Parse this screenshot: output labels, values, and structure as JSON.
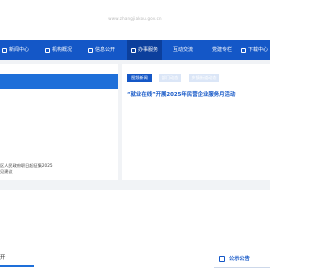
{
  "header": {
    "logo_text": "www.zhangjiakou.gov.cn"
  },
  "nav": {
    "items": [
      {
        "label": "新闻中心",
        "icon": "news-icon"
      },
      {
        "label": "机构概况",
        "icon": "building-icon"
      },
      {
        "label": "信息公开",
        "icon": "info-icon"
      },
      {
        "label": "办事服务",
        "icon": "service-icon"
      },
      {
        "label": "互动交流",
        "icon": "chat-icon"
      },
      {
        "label": "党建专栏",
        "icon": "flag-icon"
      },
      {
        "label": "下载中心",
        "icon": "download-icon"
      }
    ],
    "colors": {
      "bar": "#1457c7",
      "active": "#0c3f9c"
    }
  },
  "left_card": {
    "caption_line1": "区人民政府职日起征集2025",
    "caption_line2": "见建议"
  },
  "right_card": {
    "tabs": [
      "图频新闻",
      "部门动态",
      "乡镇街道动态"
    ],
    "headline": "“就业在线”开展2025年民营企业服务月活动"
  },
  "bottom": {
    "section_title": "开",
    "notice_label": "公示公告",
    "accent": "#1e6fd9"
  }
}
